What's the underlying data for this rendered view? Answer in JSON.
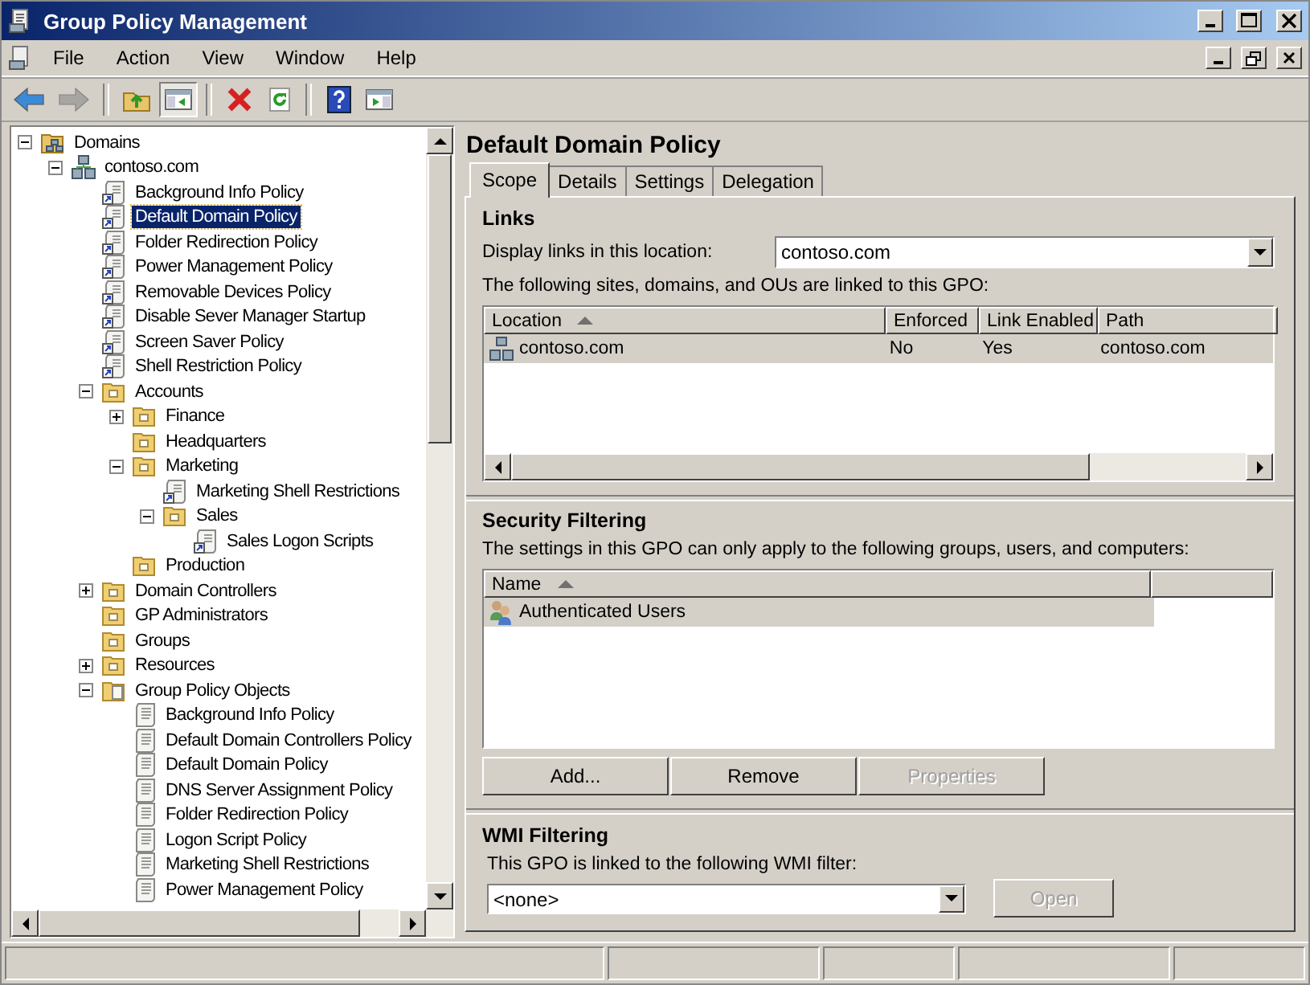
{
  "window": {
    "title": "Group Policy Management"
  },
  "menu": [
    "File",
    "Action",
    "View",
    "Window",
    "Help"
  ],
  "toolbar": [
    {
      "kind": "back",
      "disabled": false,
      "pressed": false
    },
    {
      "kind": "forward",
      "disabled": true,
      "pressed": false
    },
    {
      "kind": "up",
      "disabled": false,
      "pressed": false
    },
    {
      "kind": "tree-toggle",
      "disabled": false,
      "pressed": true
    },
    {
      "kind": "delete",
      "disabled": false,
      "pressed": false
    },
    {
      "kind": "refresh",
      "disabled": false,
      "pressed": false
    },
    {
      "kind": "help",
      "disabled": false,
      "pressed": false
    },
    {
      "kind": "action-pane",
      "disabled": false,
      "pressed": false
    }
  ],
  "tree": [
    {
      "label": "Domains",
      "kind": "domains",
      "expanded": true,
      "selected": false,
      "children": [
        {
          "label": "contoso.com",
          "kind": "domain",
          "expanded": true,
          "selected": false,
          "children": [
            {
              "label": "Background Info Policy",
              "kind": "link",
              "selected": false
            },
            {
              "label": "Default Domain Policy",
              "kind": "link",
              "selected": true
            },
            {
              "label": "Folder Redirection Policy",
              "kind": "link",
              "selected": false
            },
            {
              "label": "Power Management Policy",
              "kind": "link",
              "selected": false
            },
            {
              "label": "Removable Devices Policy",
              "kind": "link",
              "selected": false
            },
            {
              "label": "Disable Sever Manager Startup",
              "kind": "link",
              "selected": false
            },
            {
              "label": "Screen Saver Policy",
              "kind": "link",
              "selected": false
            },
            {
              "label": "Shell Restriction Policy",
              "kind": "link",
              "selected": false
            },
            {
              "label": "Accounts",
              "kind": "ou",
              "expanded": true,
              "selected": false,
              "children": [
                {
                  "label": "Finance",
                  "kind": "ou",
                  "expanded": false,
                  "selected": false
                },
                {
                  "label": "Headquarters",
                  "kind": "ou",
                  "selected": false
                },
                {
                  "label": "Marketing",
                  "kind": "ou",
                  "expanded": true,
                  "selected": false,
                  "children": [
                    {
                      "label": "Marketing Shell Restrictions",
                      "kind": "link",
                      "selected": false
                    },
                    {
                      "label": "Sales",
                      "kind": "ou",
                      "expanded": true,
                      "selected": false,
                      "children": [
                        {
                          "label": "Sales Logon Scripts",
                          "kind": "link",
                          "selected": false
                        }
                      ]
                    }
                  ]
                },
                {
                  "label": "Production",
                  "kind": "ou",
                  "selected": false
                }
              ]
            },
            {
              "label": "Domain Controllers",
              "kind": "ou",
              "expanded": false,
              "selected": false
            },
            {
              "label": "GP Administrators",
              "kind": "ou",
              "selected": false
            },
            {
              "label": "Groups",
              "kind": "ou",
              "selected": false
            },
            {
              "label": "Resources",
              "kind": "ou",
              "expanded": false,
              "selected": false
            },
            {
              "label": "Group Policy Objects",
              "kind": "gpo-folder",
              "expanded": true,
              "selected": false,
              "children": [
                {
                  "label": "Background Info Policy",
                  "kind": "gpo",
                  "selected": false
                },
                {
                  "label": "Default Domain Controllers Policy",
                  "kind": "gpo",
                  "selected": false
                },
                {
                  "label": "Default Domain Policy",
                  "kind": "gpo",
                  "selected": false
                },
                {
                  "label": "DNS Server Assignment Policy",
                  "kind": "gpo",
                  "selected": false
                },
                {
                  "label": "Folder Redirection Policy",
                  "kind": "gpo",
                  "selected": false
                },
                {
                  "label": "Logon Script Policy",
                  "kind": "gpo",
                  "selected": false
                },
                {
                  "label": "Marketing Shell Restrictions",
                  "kind": "gpo",
                  "selected": false
                },
                {
                  "label": "Power Management Policy",
                  "kind": "gpo",
                  "selected": false
                }
              ]
            }
          ]
        }
      ]
    }
  ],
  "details": {
    "title": "Default Domain Policy",
    "tabs": [
      {
        "label": "Scope",
        "selected": true
      },
      {
        "label": "Details",
        "selected": false
      },
      {
        "label": "Settings",
        "selected": false
      },
      {
        "label": "Delegation",
        "selected": false
      }
    ],
    "links": {
      "heading": "Links",
      "location_label": "Display links in this location:",
      "location_value": "contoso.com",
      "description": "The following sites, domains, and OUs are linked to this GPO:",
      "columns": [
        {
          "label": "Location",
          "sorted": true
        },
        {
          "label": "Enforced",
          "sorted": false
        },
        {
          "label": "Link Enabled",
          "sorted": false
        },
        {
          "label": "Path",
          "sorted": false
        }
      ],
      "rows": [
        {
          "cells": [
            "contoso.com",
            "No",
            "Yes",
            "contoso.com"
          ],
          "selected": true
        }
      ]
    },
    "security": {
      "heading": "Security Filtering",
      "description": "The settings in this GPO can only apply to the following groups, users, and computers:",
      "columns": [
        {
          "label": "Name",
          "sorted": true
        }
      ],
      "rows": [
        {
          "name": "Authenticated Users",
          "selected": true
        }
      ],
      "buttons": [
        {
          "label": "Add...",
          "disabled": false
        },
        {
          "label": "Remove",
          "disabled": false
        },
        {
          "label": "Properties",
          "disabled": true
        }
      ]
    },
    "wmi": {
      "heading": "WMI Filtering",
      "description": "This GPO is linked to the following WMI filter:",
      "filter_value": "<none>",
      "button": {
        "label": "Open",
        "disabled": true
      }
    }
  }
}
